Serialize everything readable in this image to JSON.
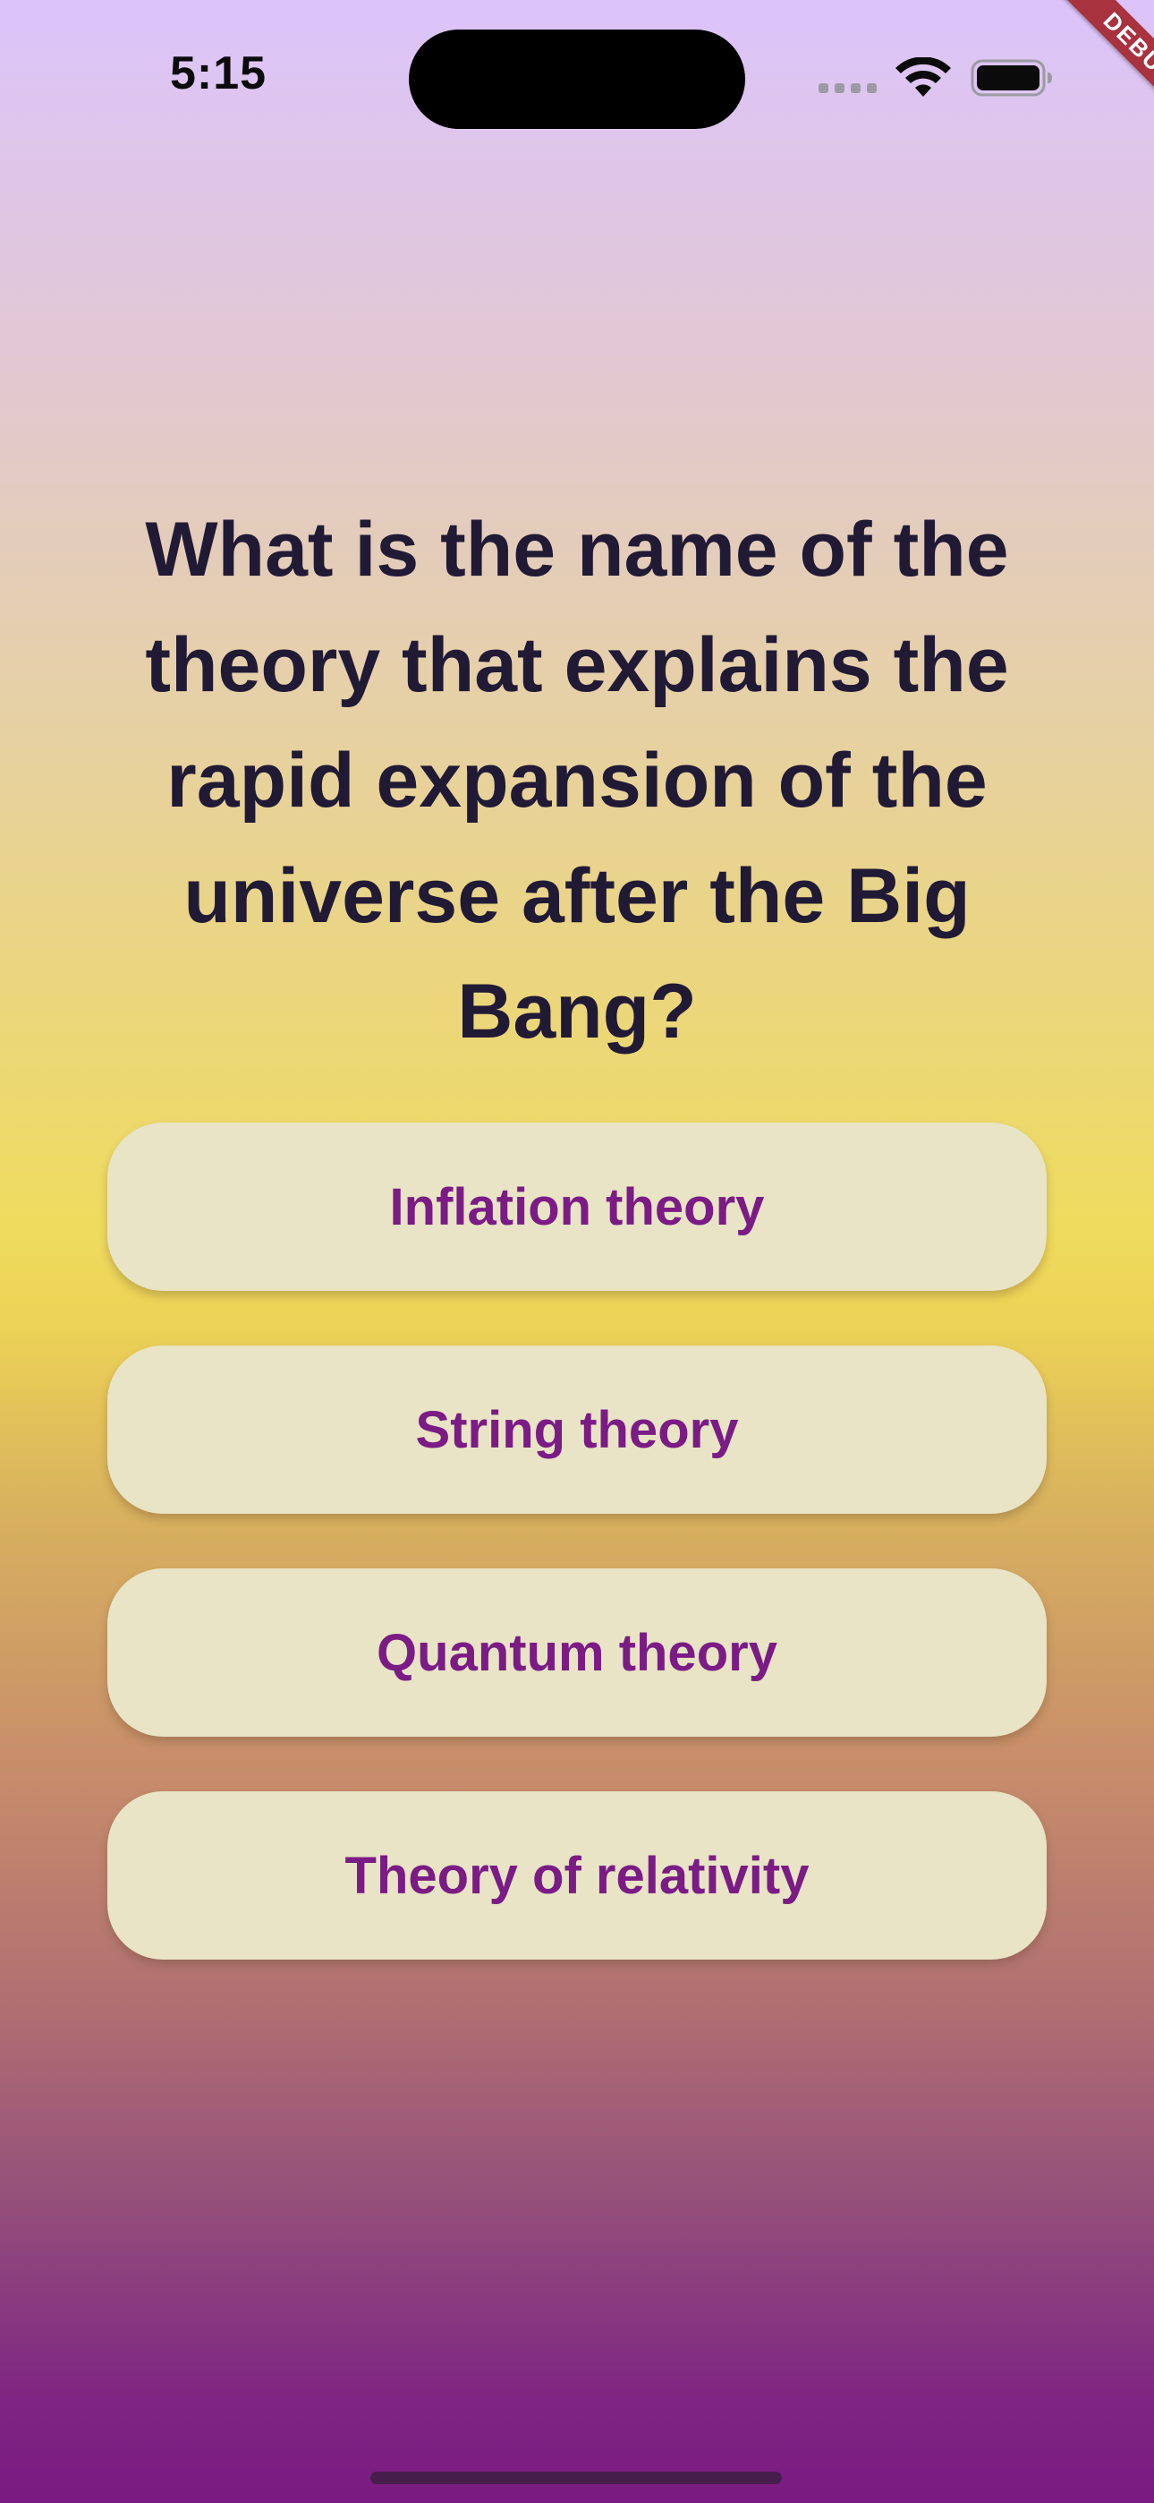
{
  "status_bar": {
    "time": "5:15",
    "icons": [
      "cellular-signal-icon",
      "wifi-icon",
      "battery-icon"
    ]
  },
  "debug_banner": {
    "label": "DEBUG",
    "color": "#a8323e"
  },
  "quiz": {
    "question": "What is the name of the theory that explains the rapid expansion of the universe after the Big Bang?",
    "answers": [
      "Inflation theory",
      "String theory",
      "Quantum theory",
      "Theory of relativity"
    ]
  },
  "colors": {
    "question_text": "#211a35",
    "answer_text": "#7b1b85",
    "answer_background": "#e8e4c5",
    "gradient_top": "#dcc4fb",
    "gradient_middle": "#efdc5e",
    "gradient_bottom": "#7a1a82"
  }
}
